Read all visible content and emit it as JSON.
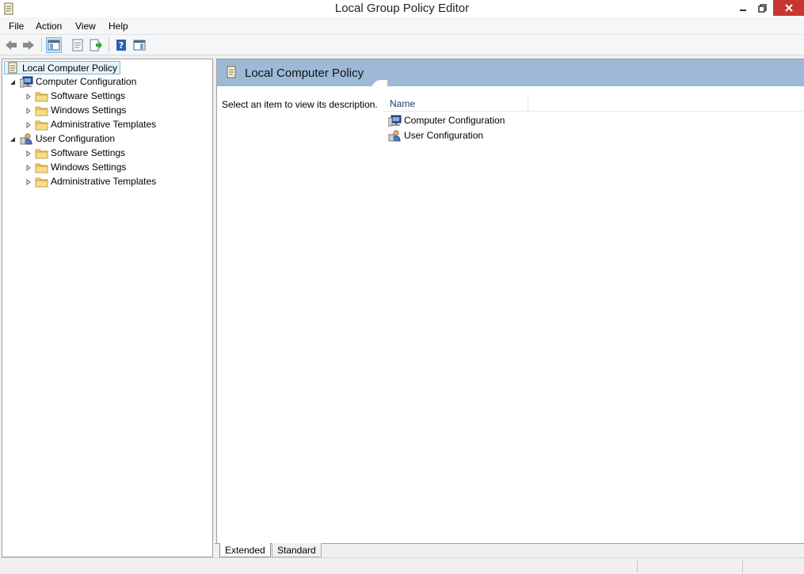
{
  "window": {
    "title": "Local Group Policy Editor",
    "controls": [
      "minimize",
      "restore",
      "close"
    ]
  },
  "menu": {
    "items": [
      {
        "label": "File"
      },
      {
        "label": "Action"
      },
      {
        "label": "View"
      },
      {
        "label": "Help"
      }
    ]
  },
  "toolbar": {
    "buttons": [
      {
        "icon": "back-arrow-icon"
      },
      {
        "icon": "forward-arrow-icon"
      },
      {
        "icon": "show-hide-console-tree-icon",
        "active": true
      },
      {
        "icon": "properties-icon"
      },
      {
        "icon": "export-list-icon"
      },
      {
        "icon": "help-icon"
      },
      {
        "icon": "action-pane-icon"
      }
    ]
  },
  "tree": {
    "root": {
      "label": "Local Computer Policy",
      "icon": "policy-document-icon",
      "selected": true
    },
    "nodes": [
      {
        "label": "Computer Configuration",
        "icon": "computer-config-icon",
        "expanded": true,
        "children": [
          {
            "label": "Software Settings",
            "icon": "folder-icon"
          },
          {
            "label": "Windows Settings",
            "icon": "folder-icon"
          },
          {
            "label": "Administrative Templates",
            "icon": "folder-icon"
          }
        ]
      },
      {
        "label": "User Configuration",
        "icon": "user-config-icon",
        "expanded": true,
        "children": [
          {
            "label": "Software Settings",
            "icon": "folder-icon"
          },
          {
            "label": "Windows Settings",
            "icon": "folder-icon"
          },
          {
            "label": "Administrative Templates",
            "icon": "folder-icon"
          }
        ]
      }
    ]
  },
  "content": {
    "header_title": "Local Computer Policy",
    "description": "Select an item to view its description.",
    "column_header": "Name",
    "items": [
      {
        "label": "Computer Configuration",
        "icon": "computer-config-icon"
      },
      {
        "label": "User Configuration",
        "icon": "user-config-icon"
      }
    ]
  },
  "tabs": [
    {
      "label": "Extended",
      "active": true
    },
    {
      "label": "Standard",
      "active": false
    }
  ],
  "colors": {
    "header_bg": "#9db9d7",
    "close_button": "#c7372f",
    "selection_bg": "#e5f3fb",
    "folder": "#f2cf6e"
  }
}
